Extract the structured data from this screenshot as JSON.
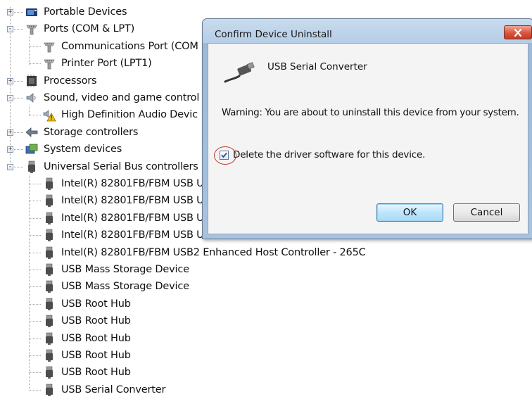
{
  "tree": {
    "items": [
      {
        "label": "Portable Devices",
        "icon": "portable-device-icon",
        "level": 0,
        "expander": "+"
      },
      {
        "label": "Ports (COM & LPT)",
        "icon": "port-icon",
        "level": 0,
        "expander": "-"
      },
      {
        "label": "Communications Port (COM",
        "icon": "port-icon",
        "level": 1,
        "expander": ""
      },
      {
        "label": "Printer Port (LPT1)",
        "icon": "port-icon",
        "level": 1,
        "expander": ""
      },
      {
        "label": "Processors",
        "icon": "processor-icon",
        "level": 0,
        "expander": "+"
      },
      {
        "label": "Sound, video and game control",
        "icon": "speaker-icon",
        "level": 0,
        "expander": "-"
      },
      {
        "label": "High Definition Audio Devic",
        "icon": "audio-warning-icon",
        "level": 1,
        "expander": ""
      },
      {
        "label": "Storage controllers",
        "icon": "storage-icon",
        "level": 0,
        "expander": "+"
      },
      {
        "label": "System devices",
        "icon": "system-device-icon",
        "level": 0,
        "expander": "+"
      },
      {
        "label": "Universal Serial Bus controllers",
        "icon": "usb-icon",
        "level": 0,
        "expander": "-"
      },
      {
        "label": "Intel(R) 82801FB/FBM USB U",
        "icon": "usb-icon",
        "level": 1,
        "expander": ""
      },
      {
        "label": "Intel(R) 82801FB/FBM USB U",
        "icon": "usb-icon",
        "level": 1,
        "expander": ""
      },
      {
        "label": "Intel(R) 82801FB/FBM USB U",
        "icon": "usb-icon",
        "level": 1,
        "expander": ""
      },
      {
        "label": "Intel(R) 82801FB/FBM USB U",
        "icon": "usb-icon",
        "level": 1,
        "expander": ""
      },
      {
        "label": "Intel(R) 82801FB/FBM USB2 Enhanced Host Controller - 265C",
        "icon": "usb-icon",
        "level": 1,
        "expander": ""
      },
      {
        "label": "USB Mass Storage Device",
        "icon": "usb-icon",
        "level": 1,
        "expander": ""
      },
      {
        "label": "USB Mass Storage Device",
        "icon": "usb-icon",
        "level": 1,
        "expander": ""
      },
      {
        "label": "USB Root Hub",
        "icon": "usb-icon",
        "level": 1,
        "expander": ""
      },
      {
        "label": "USB Root Hub",
        "icon": "usb-icon",
        "level": 1,
        "expander": ""
      },
      {
        "label": "USB Root Hub",
        "icon": "usb-icon",
        "level": 1,
        "expander": ""
      },
      {
        "label": "USB Root Hub",
        "icon": "usb-icon",
        "level": 1,
        "expander": ""
      },
      {
        "label": "USB Root Hub",
        "icon": "usb-icon",
        "level": 1,
        "expander": ""
      },
      {
        "label": "USB Serial Converter",
        "icon": "usb-icon",
        "level": 1,
        "expander": ""
      }
    ]
  },
  "dialog": {
    "title": "Confirm Device Uninstall",
    "close_icon": "close-icon",
    "device_icon": "usb-plug-icon",
    "device_name": "USB Serial Converter",
    "warning": "Warning: You are about to uninstall this device from your system.",
    "checkbox_label": "Delete the driver software for this device.",
    "checkbox_checked": true,
    "ok_label": "OK",
    "cancel_label": "Cancel",
    "highlight_color": "#c0392b"
  }
}
